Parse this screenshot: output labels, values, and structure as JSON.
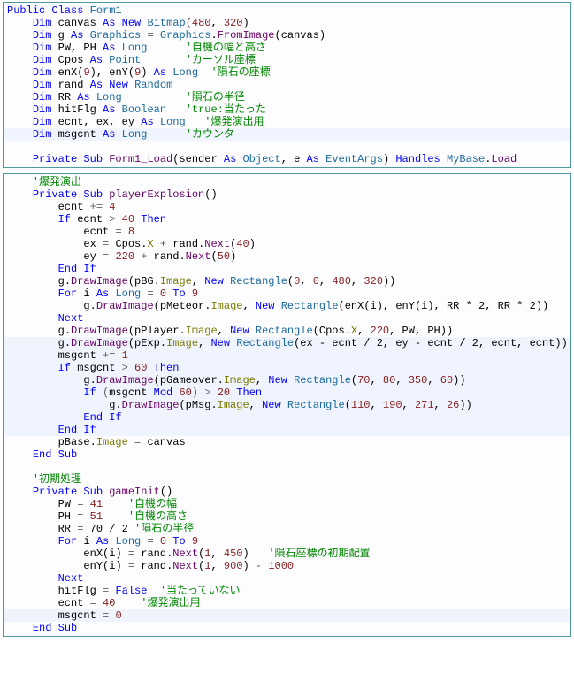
{
  "block1": {
    "l1": {
      "kw1": "Public Class",
      "cls": "Form1"
    },
    "l2": {
      "kw": "Dim",
      "v": "canvas",
      "kw2": "As New",
      "t": "Bitmap",
      "a1": "480",
      "a2": "320"
    },
    "l3": {
      "kw": "Dim",
      "v": "g",
      "kw2": "As",
      "t": "Graphics",
      "eq": "=",
      "cls": "Graphics",
      "m": "FromImage",
      "a": "canvas"
    },
    "l4": {
      "kw": "Dim",
      "v": "PW, PH",
      "kw2": "As",
      "t": "Long",
      "c": "'自機の幅と高さ"
    },
    "l5": {
      "kw": "Dim",
      "v": "Cpos",
      "kw2": "As",
      "t": "Point",
      "c": "'カーソル座標"
    },
    "l6": {
      "kw": "Dim",
      "v1": "enX",
      "i1": "9",
      "v2": "enY",
      "i2": "9",
      "kw2": "As",
      "t": "Long",
      "c": "'隕石の座標"
    },
    "l7": {
      "kw": "Dim",
      "v": "rand",
      "kw2": "As New",
      "t": "Random"
    },
    "l8": {
      "kw": "Dim",
      "v": "RR",
      "kw2": "As",
      "t": "Long",
      "c": "'隕石の半径"
    },
    "l9": {
      "kw": "Dim",
      "v": "hitFlg",
      "kw2": "As",
      "t": "Boolean",
      "c": "'true:当たった"
    },
    "l10": {
      "kw": "Dim",
      "v": "ecnt, ex, ey",
      "kw2": "As",
      "t": "Long",
      "c": "'爆発演出用"
    },
    "l11": {
      "kw": "Dim",
      "v": "msgcnt",
      "kw2": "As",
      "t": "Long",
      "c": "'カウンタ"
    },
    "l12": {
      "kw1": "Private Sub",
      "fn": "Form1_Load",
      "p1": "sender",
      "kw2": "As",
      "t1": "Object",
      "p2": "e",
      "kw3": "As",
      "t2": "EventArgs",
      "kw4": "Handles",
      "ev": "MyBase",
      "m": "Load"
    }
  },
  "block2": {
    "c1": "'爆発演出",
    "s1": {
      "kw": "Private Sub",
      "fn": "playerExplosion"
    },
    "l1": {
      "v": "ecnt",
      "op": "+=",
      "n": "4"
    },
    "l2": {
      "kw": "If",
      "v": "ecnt",
      "op": ">",
      "n": "40",
      "kw2": "Then"
    },
    "l3": {
      "v": "ecnt",
      "eq": "=",
      "n": "8"
    },
    "l4": {
      "v": "ex",
      "eq": "=",
      "o": "Cpos",
      "p": "X",
      "op": "+",
      "o2": "rand",
      "m": "Next",
      "n": "40"
    },
    "l5": {
      "v": "ey",
      "eq": "=",
      "n1": "220",
      "op": "+",
      "o": "rand",
      "m": "Next",
      "n2": "50"
    },
    "l6": {
      "kw": "End If"
    },
    "l7": {
      "o": "g",
      "m": "DrawImage",
      "a1": "pBG",
      "p1": "Image",
      "kw": "New",
      "t": "Rectangle",
      "n1": "0",
      "n2": "0",
      "n3": "480",
      "n4": "320"
    },
    "l8": {
      "kw": "For",
      "v": "i",
      "kw2": "As",
      "t": "Long",
      "eq": "=",
      "n1": "0",
      "kw3": "To",
      "n2": "9"
    },
    "l9": {
      "o": "g",
      "m": "DrawImage",
      "a1": "pMeteor",
      "p1": "Image",
      "kw": "New",
      "t": "Rectangle",
      "a2": "enX",
      "i2": "i",
      "a3": "enY",
      "i3": "i",
      "e1": "RR * 2",
      "e2": "RR * 2"
    },
    "l10": {
      "kw": "Next"
    },
    "l11": {
      "o": "g",
      "m": "DrawImage",
      "a1": "pPlayer",
      "p1": "Image",
      "kw": "New",
      "t": "Rectangle",
      "a2": "Cpos",
      "p2": "X",
      "n": "220",
      "v1": "PW",
      "v2": "PH"
    },
    "l12": {
      "o": "g",
      "m": "DrawImage",
      "a1": "pExp",
      "p1": "Image",
      "kw": "New",
      "t": "Rectangle",
      "e1": "ex - ecnt / 2",
      "e2": "ey - ecnt / 2",
      "v1": "ecnt",
      "v2": "ecnt"
    },
    "l13": {
      "v": "msgcnt",
      "op": "+=",
      "n": "1"
    },
    "l14": {
      "kw": "If",
      "v": "msgcnt",
      "op": ">",
      "n": "60",
      "kw2": "Then"
    },
    "l15": {
      "o": "g",
      "m": "DrawImage",
      "a1": "pGameover",
      "p1": "Image",
      "kw": "New",
      "t": "Rectangle",
      "n1": "70",
      "n2": "80",
      "n3": "350",
      "n4": "60"
    },
    "l16": {
      "kw": "If",
      "lp": "(",
      "v": "msgcnt",
      "kw2": "Mod",
      "n1": "60",
      "rp": ")",
      "op": ">",
      "n2": "20",
      "kw3": "Then"
    },
    "l17": {
      "o": "g",
      "m": "DrawImage",
      "a1": "pMsg",
      "p1": "Image",
      "kw": "New",
      "t": "Rectangle",
      "n1": "110",
      "n2": "190",
      "n3": "271",
      "n4": "26"
    },
    "l18": {
      "kw": "End If"
    },
    "l19": {
      "kw": "End If"
    },
    "l20": {
      "o": "pBase",
      "p": "Image",
      "eq": "=",
      "v": "canvas"
    },
    "l21": {
      "kw": "End Sub"
    },
    "c2": "'初期処理",
    "s2": {
      "kw": "Private Sub",
      "fn": "gameInit"
    },
    "g1": {
      "v": "PW",
      "eq": "=",
      "n": "41",
      "c": "'自機の幅"
    },
    "g2": {
      "v": "PH",
      "eq": "=",
      "n": "51",
      "c": "'自機の高さ"
    },
    "g3": {
      "v": "RR",
      "eq": "=",
      "e": "70 / 2",
      "c": "'隕石の半径"
    },
    "g4": {
      "kw": "For",
      "v": "i",
      "kw2": "As",
      "t": "Long",
      "eq": "=",
      "n1": "0",
      "kw3": "To",
      "n2": "9"
    },
    "g5": {
      "v": "enX",
      "i": "i",
      "eq": "=",
      "o": "rand",
      "m": "Next",
      "n1": "1",
      "n2": "450",
      "c": "'隕石座標の初期配置"
    },
    "g6": {
      "v": "enY",
      "i": "i",
      "eq": "=",
      "o": "rand",
      "m": "Next",
      "n1": "1",
      "n2": "900",
      "op": "-",
      "n3": "1000"
    },
    "g7": {
      "kw": "Next"
    },
    "g8": {
      "v": "hitFlg",
      "eq": "=",
      "kw": "False",
      "c": "'当たっていない"
    },
    "g9": {
      "v": "ecnt",
      "eq": "=",
      "n": "40",
      "c": "'爆発演出用"
    },
    "g10": {
      "v": "msgcnt",
      "eq": "=",
      "n": "0"
    },
    "g11": {
      "kw": "End Sub"
    }
  }
}
